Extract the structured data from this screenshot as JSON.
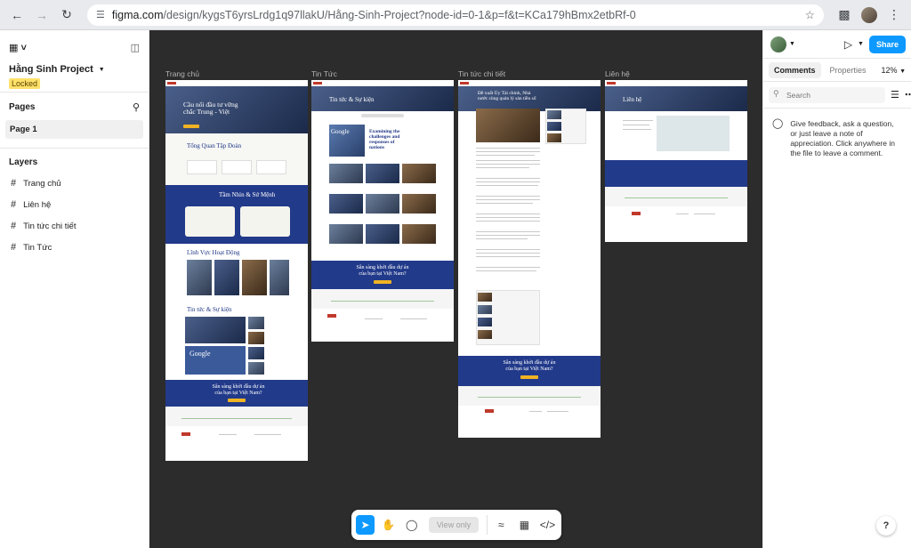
{
  "browser": {
    "url_host": "figma.com",
    "url_path": "/design/kygsT6yrsLrdg1q97llakU/Hằng-Sinh-Project?node-id=0-1&p=f&t=KCa179hBmx2etbRf-0"
  },
  "left_panel": {
    "project_name": "Hằng Sinh Project",
    "locked_label": "Locked",
    "pages_title": "Pages",
    "pages": [
      "Page 1"
    ],
    "layers_title": "Layers",
    "layers": [
      "Trang chủ",
      "Liên hệ",
      "Tin tức chi tiết",
      "Tin Tức"
    ]
  },
  "canvas": {
    "frames": [
      {
        "label": "Trang chủ"
      },
      {
        "label": "Tin Tức"
      },
      {
        "label": "Tin tức chi tiết"
      },
      {
        "label": "Liên hệ"
      }
    ],
    "home_hero_title": "Cầu nối đầu tư vững chắc Trung - Việt",
    "home_overview": "Tổng Quan Tập Đoàn",
    "home_vision": "Tầm Nhìn & Sứ Mệnh",
    "home_fields": "Lĩnh Vực Hoạt Động",
    "home_news": "Tin tức & Sự kiện",
    "cta_title": "Sẵn sàng khởi đầu dự án của bạn tại Việt Nam?",
    "news_header": "Tin tức & Sự kiện",
    "news_feature": "Examining the challenges and responses of nations",
    "news_detail_title": "Đề xuất Ủy Tài chính, Nhà nước cùng quản lý sản tiền số",
    "contact_header": "Liên hệ",
    "google_label": "Google"
  },
  "toolbar": {
    "view_only_label": "View only"
  },
  "right_panel": {
    "share_label": "Share",
    "tabs": [
      "Comments",
      "Properties"
    ],
    "zoom": "12%",
    "search_placeholder": "Search",
    "feedback_text": "Give feedback, ask a question, or just leave a note of appreciation. Click anywhere in the file to leave a comment.",
    "help_label": "?"
  },
  "colors": {
    "accent": "#0d99ff",
    "canvas_bg": "#2c2c2c",
    "site_navy": "#223a8a",
    "site_yellow": "#f0b323",
    "locked_yellow": "#ffe16b"
  }
}
